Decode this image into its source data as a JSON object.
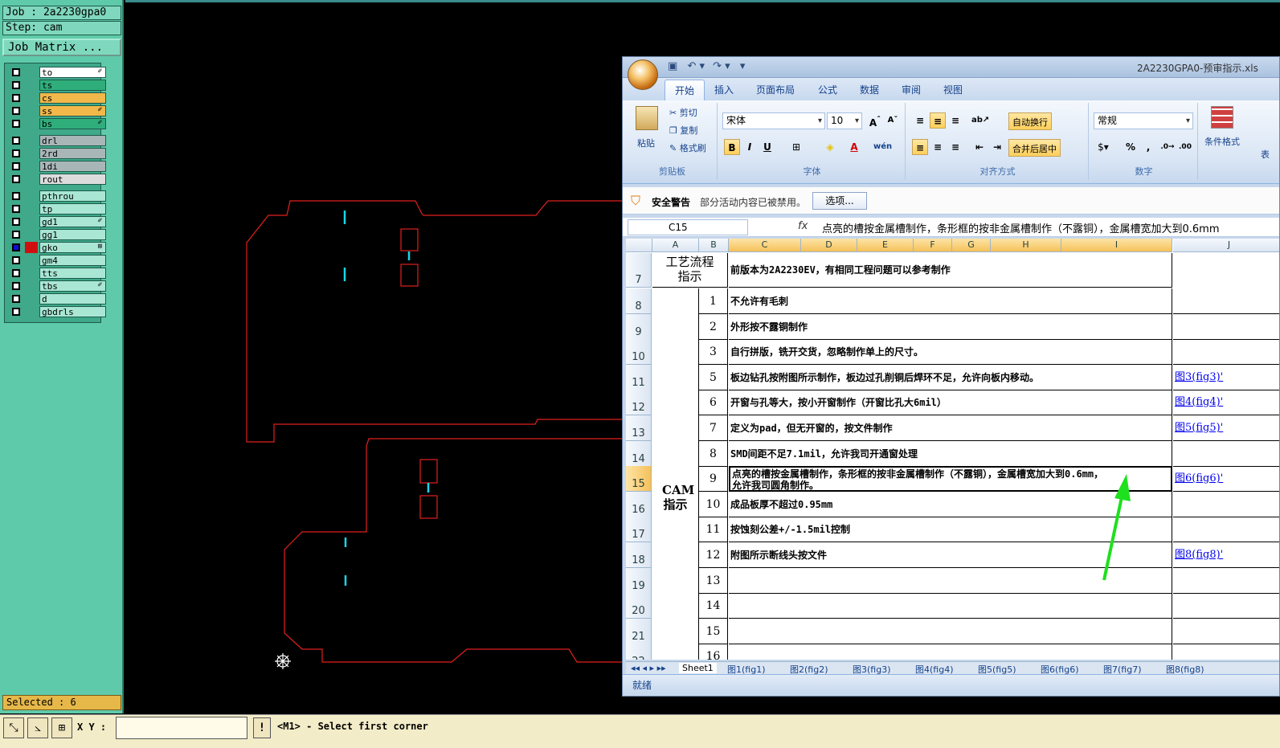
{
  "left_panel": {
    "job": "Job : 2a2230gpa0",
    "step": "Step: cam",
    "job_matrix": "Job Matrix ...",
    "selected": "Selected : 6",
    "layers": [
      {
        "name": "to",
        "color": "#ffffff",
        "mark": "✐"
      },
      {
        "name": "ts",
        "color": "#2fae7c",
        "mark": ""
      },
      {
        "name": "cs",
        "color": "#f2b84a",
        "mark": ""
      },
      {
        "name": "ss",
        "color": "#f2b84a",
        "mark": "✐"
      },
      {
        "name": "bs",
        "color": "#2fae7c",
        "mark": "✐"
      },
      {
        "name": "drl",
        "color": "#a9b6b8",
        "mark": ""
      },
      {
        "name": "2rd",
        "color": "#a9b6b8",
        "mark": ""
      },
      {
        "name": "1di",
        "color": "#a9b6b8",
        "mark": ""
      },
      {
        "name": "rout",
        "color": "#dcdcdc",
        "mark": ""
      },
      {
        "name": "pthrou",
        "color": "#a9e6d4",
        "mark": ""
      },
      {
        "name": "tp",
        "color": "#a9e6d4",
        "mark": ""
      },
      {
        "name": "gd1",
        "color": "#a9e6d4",
        "mark": "✐"
      },
      {
        "name": "gg1",
        "color": "#a9e6d4",
        "mark": ""
      },
      {
        "name": "gko",
        "color": "#a9e6d4",
        "mark": "⊞"
      },
      {
        "name": "gm4",
        "color": "#a9e6d4",
        "mark": ""
      },
      {
        "name": "tts",
        "color": "#a9e6d4",
        "mark": ""
      },
      {
        "name": "tbs",
        "color": "#a9e6d4",
        "mark": "✐"
      },
      {
        "name": "d",
        "color": "#a9e6d4",
        "mark": ""
      },
      {
        "name": "gbdrls",
        "color": "#a9e6d4",
        "mark": ""
      }
    ]
  },
  "bottom_bar": {
    "xy_label": "X Y :",
    "xy_value": "",
    "message": "<M1> - Select first corner"
  },
  "excel": {
    "title": "2A2230GPA0-预审指示.xls",
    "tabs": [
      "开始",
      "插入",
      "页面布局",
      "公式",
      "数据",
      "审阅",
      "视图"
    ],
    "clipboard": {
      "paste": "粘贴",
      "cut": "剪切",
      "copy": "复制",
      "format_painter": "格式刷",
      "label": "剪贴板"
    },
    "font": {
      "name": "宋体",
      "size": "10",
      "label": "字体"
    },
    "align": {
      "wrap": "自动换行",
      "merge": "合并后居中",
      "label": "对齐方式"
    },
    "number": {
      "format": "常规",
      "label": "数字"
    },
    "styles": {
      "cond": "条件格式",
      "table": "表"
    },
    "security": {
      "title": "安全警告",
      "message": "部分活动内容已被禁用。",
      "button": "选项..."
    },
    "namebox": "C15",
    "formula": "点亮的槽按金属槽制作，条形框的按非金属槽制作（不露铜），金属槽宽加大到0.6mm",
    "columns": [
      "A",
      "B",
      "C",
      "D",
      "E",
      "F",
      "G",
      "H",
      "I",
      "J"
    ],
    "row7_label": "工艺流程指示",
    "row7_text": "前版本为2A2230EV，有相同工程问题可以参考制作",
    "cam_label": "CAM指示",
    "rows": [
      {
        "row": "8",
        "num": "1",
        "text": "不允许有毛刺",
        "link": ""
      },
      {
        "row": "9",
        "num": "2",
        "text": "外形按不露铜制作",
        "link": ""
      },
      {
        "row": "10",
        "num": "3",
        "text": "自行拼版，铣开交货，忽略制作单上的尺寸。",
        "link": ""
      },
      {
        "row": "11",
        "num": "5",
        "text": "板边钻孔按附图所示制作，板边过孔削铜后焊环不足，允许向板内移动。",
        "link": "图3(fig3)'"
      },
      {
        "row": "12",
        "num": "6",
        "text": "开窗与孔等大，按小开窗制作（开窗比孔大6mil）",
        "link": "图4(fig4)'"
      },
      {
        "row": "13",
        "num": "7",
        "text": "定义为pad，但无开窗的，按文件制作",
        "link": "图5(fig5)'"
      },
      {
        "row": "14",
        "num": "8",
        "text": "SMD间距不足7.1mil，允许我司开通窗处理",
        "link": ""
      },
      {
        "row": "15",
        "num": "9",
        "text": "点亮的槽按金属槽制作，条形框的按非金属槽制作（不露铜），金属槽宽加大到0.6mm，",
        "text2": "允许我司圆角制作。",
        "link": "图6(fig6)'"
      },
      {
        "row": "16",
        "num": "10",
        "text": "成品板厚不超过0.95mm",
        "link": ""
      },
      {
        "row": "17",
        "num": "11",
        "text": "按蚀刻公差+/-1.5mil控制",
        "link": ""
      },
      {
        "row": "18",
        "num": "12",
        "text": "附图所示断线头按文件",
        "link": "图8(fig8)'"
      },
      {
        "row": "19",
        "num": "13",
        "text": "",
        "link": ""
      },
      {
        "row": "20",
        "num": "14",
        "text": "",
        "link": ""
      },
      {
        "row": "21",
        "num": "15",
        "text": "",
        "link": ""
      },
      {
        "row": "22",
        "num": "16",
        "text": "",
        "link": ""
      }
    ],
    "sheet_tabs": [
      "Sheet1",
      "图1(fig1)",
      "图2(fig2)",
      "图3(fig3)",
      "图4(fig4)",
      "图5(fig5)",
      "图6(fig6)",
      "图7(fig7)",
      "图8(fig8)"
    ],
    "status": "就绪"
  },
  "colors": {
    "outline": "#e0201e",
    "slot": "#18d6e6",
    "arrow": "#1ee01e",
    "panel": "#5fcaa9"
  }
}
